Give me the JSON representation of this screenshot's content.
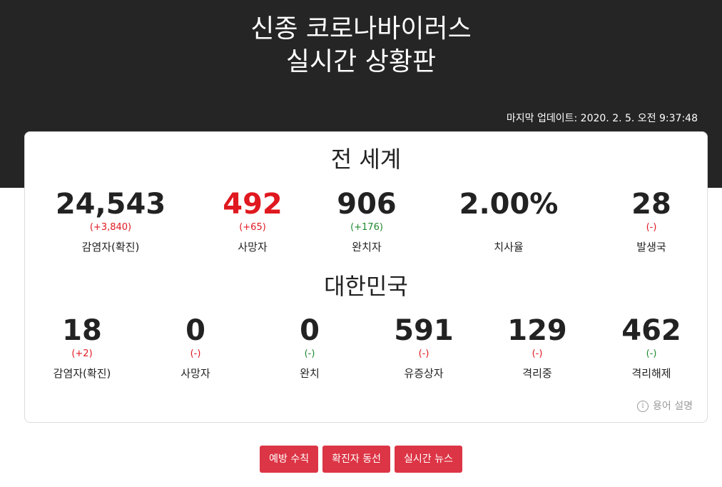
{
  "header": {
    "title_line1": "신종 코로나바이러스",
    "title_line2": "실시간 상황판",
    "last_updated": "마지막 업데이트: 2020. 2. 5. 오전 9:37:48"
  },
  "world": {
    "title": "전 세계",
    "stats": [
      {
        "value": "24,543",
        "delta": "(+3,840)",
        "label": "감염자(확진)"
      },
      {
        "value": "492",
        "delta": "(+65)",
        "label": "사망자"
      },
      {
        "value": "906",
        "delta": "(+176)",
        "label": "완치자"
      },
      {
        "value": "2.00%",
        "delta": "",
        "label": "치사율"
      },
      {
        "value": "28",
        "delta": "(-)",
        "label": "발생국"
      }
    ]
  },
  "korea": {
    "title": "대한민국",
    "stats": [
      {
        "value": "18",
        "delta": "(+2)",
        "label": "감염자(확진)"
      },
      {
        "value": "0",
        "delta": "(-)",
        "label": "사망자"
      },
      {
        "value": "0",
        "delta": "(-)",
        "label": "완치"
      },
      {
        "value": "591",
        "delta": "(-)",
        "label": "유증상자"
      },
      {
        "value": "129",
        "delta": "(-)",
        "label": "격리중"
      },
      {
        "value": "462",
        "delta": "(-)",
        "label": "격리해제"
      }
    ]
  },
  "help": {
    "icon": "info-icon",
    "glyph": "i",
    "label": "용어 설명"
  },
  "buttons": {
    "prevention": "예방 수칙",
    "patient_route": "확진자 동선",
    "news": "실시간 뉴스"
  },
  "colors": {
    "header_bg": "#252525",
    "increase_red": "#e0181f",
    "recovered_green": "#1f8a2e",
    "button_red": "#dc3545"
  }
}
